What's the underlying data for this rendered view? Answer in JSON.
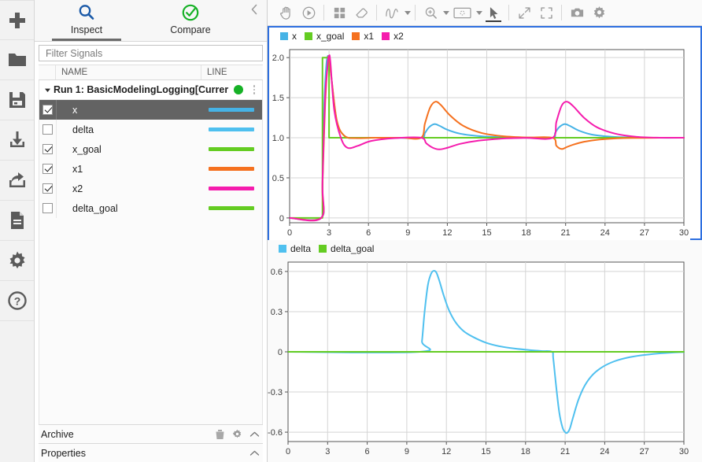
{
  "rail": {
    "items": [
      {
        "name": "add-icon",
        "label": "Add"
      },
      {
        "name": "open-folder-icon",
        "label": "Open"
      },
      {
        "name": "save-icon",
        "label": "Save"
      },
      {
        "name": "import-icon",
        "label": "Import"
      },
      {
        "name": "share-export-icon",
        "label": "Share"
      },
      {
        "name": "report-icon",
        "label": "Report"
      },
      {
        "name": "preferences-gear-icon",
        "label": "Preferences"
      },
      {
        "name": "help-icon",
        "label": "Help"
      }
    ]
  },
  "panel": {
    "tabs": [
      {
        "label": "Inspect",
        "icon": "search-icon",
        "active": true
      },
      {
        "label": "Compare",
        "icon": "compare-check-icon",
        "active": false
      }
    ],
    "collapse_icon": "chevron-left-icon",
    "filter": {
      "value": "",
      "placeholder": "Filter Signals"
    },
    "columns": {
      "check": "",
      "name": "NAME",
      "line": "LINE"
    },
    "run": {
      "label": "Run 1: BasicModelingLogging[Currer",
      "expanded": true,
      "dot_color": "#16b126"
    },
    "signals": [
      {
        "name": "x",
        "checked": true,
        "color": "#46b3e6",
        "selected": true
      },
      {
        "name": "delta",
        "checked": false,
        "color": "#4fc0ef",
        "selected": false
      },
      {
        "name": "x_goal",
        "checked": true,
        "color": "#64cc22",
        "selected": false
      },
      {
        "name": "x1",
        "checked": true,
        "color": "#f5711f",
        "selected": false
      },
      {
        "name": "x2",
        "checked": true,
        "color": "#f51cad",
        "selected": false
      },
      {
        "name": "delta_goal",
        "checked": false,
        "color": "#64cc22",
        "selected": false
      }
    ],
    "sections": [
      {
        "label": "Archive",
        "icons": [
          "trash-icon",
          "gear-icon",
          "chevron-up-icon"
        ]
      },
      {
        "label": "Properties",
        "icons": [
          "chevron-up-icon"
        ]
      }
    ]
  },
  "toolbar": {
    "groups": [
      [
        {
          "name": "pan-hand-icon",
          "label": "Pan",
          "caret": false,
          "active": false
        },
        {
          "name": "play-cursor-icon",
          "label": "Cursors",
          "caret": false,
          "active": false
        }
      ],
      [
        {
          "name": "subplot-layout-icon",
          "label": "Subplot Layout",
          "caret": false,
          "active": false
        },
        {
          "name": "eraser-icon",
          "label": "Clear",
          "caret": false,
          "active": false
        }
      ],
      [
        {
          "name": "signal-style-icon",
          "label": "Signal Style",
          "caret": true,
          "active": false
        }
      ],
      [
        {
          "name": "zoom-in-icon",
          "label": "Zoom In",
          "caret": true,
          "active": false
        },
        {
          "name": "fit-to-view-icon",
          "label": "Fit to View",
          "caret": true,
          "active": false
        },
        {
          "name": "arrow-pointer-icon",
          "label": "Select",
          "caret": false,
          "active": true
        }
      ],
      [
        {
          "name": "expand-diagonal-icon",
          "label": "Expand",
          "caret": false,
          "active": false
        },
        {
          "name": "fullscreen-icon",
          "label": "Full Screen",
          "caret": false,
          "active": false
        }
      ],
      [
        {
          "name": "snapshot-camera-icon",
          "label": "Snapshot",
          "caret": false,
          "active": false
        },
        {
          "name": "settings-gear-icon",
          "label": "Settings",
          "caret": false,
          "active": false
        }
      ]
    ]
  },
  "chart_data": [
    {
      "id": "upper",
      "type": "line",
      "title": "",
      "xlabel": "",
      "ylabel": "",
      "xlim": [
        0,
        30
      ],
      "ylim": [
        -0.06,
        2.1
      ],
      "xticks": [
        0,
        3,
        6,
        9,
        12,
        15,
        18,
        21,
        24,
        27,
        30
      ],
      "yticks": [
        0,
        0.5,
        1.0,
        1.5,
        2.0
      ],
      "ytick_labels": [
        "0",
        "0.5",
        "1.0",
        "1.5",
        "2.0"
      ],
      "grid": true,
      "legend_position": "top-left",
      "selected": true,
      "series": [
        {
          "name": "x",
          "color": "#46b3e6",
          "x": [
            0,
            2.4,
            2.5,
            2.6,
            2.8,
            3.0,
            3.2,
            3.6,
            4.2,
            5.0,
            6.0,
            8.0,
            10.0,
            10.3,
            10.6,
            11.0,
            11.4,
            12.0,
            13.0,
            14.5,
            16.0,
            18.0,
            20.0,
            20.2,
            20.5,
            20.9,
            21.3,
            22.0,
            23.0,
            24.5,
            26.0,
            28.0,
            30.0
          ],
          "y": [
            0,
            0,
            0.35,
            1.25,
            1.92,
            2.0,
            1.72,
            1.2,
            1.02,
            0.995,
            1.0,
            1.0,
            1.0,
            1.06,
            1.13,
            1.17,
            1.15,
            1.1,
            1.05,
            1.02,
            1.008,
            1.001,
            1.0,
            1.06,
            1.13,
            1.17,
            1.15,
            1.09,
            1.04,
            1.013,
            1.004,
            1.0,
            1.0
          ]
        },
        {
          "name": "x_goal",
          "color": "#64cc22",
          "x": [
            0,
            2.5,
            2.5,
            3.0,
            3.0,
            30
          ],
          "y": [
            0,
            0,
            2.0,
            2.0,
            1.0,
            1.0
          ]
        },
        {
          "name": "x1",
          "color": "#f5711f",
          "x": [
            0,
            2.4,
            2.5,
            2.7,
            2.9,
            3.0,
            3.2,
            3.6,
            4.2,
            5.2,
            6.5,
            8.5,
            10.0,
            10.3,
            10.7,
            11.1,
            11.5,
            12.2,
            13.2,
            14.6,
            16.2,
            18.0,
            20.0,
            20.3,
            20.7,
            21.1,
            21.6,
            22.4,
            23.4,
            24.8,
            26.4,
            28.2,
            30.0
          ],
          "y": [
            0,
            0,
            0.4,
            1.4,
            1.93,
            2.0,
            1.72,
            1.21,
            1.02,
            0.995,
            1.0,
            1.0,
            1.0,
            1.18,
            1.38,
            1.45,
            1.41,
            1.28,
            1.15,
            1.06,
            1.02,
            1.004,
            1.0,
            0.9,
            0.86,
            0.885,
            0.915,
            0.95,
            0.975,
            0.992,
            0.998,
            1.0,
            1.0
          ]
        },
        {
          "name": "x2",
          "color": "#f51cad",
          "x": [
            0,
            2.4,
            2.5,
            2.7,
            2.9,
            3.0,
            3.1,
            3.4,
            3.9,
            4.4,
            5.2,
            6.2,
            8.0,
            10.0,
            10.4,
            10.9,
            11.4,
            12.0,
            13.0,
            14.4,
            16.2,
            18.0,
            20.0,
            20.3,
            20.7,
            21.1,
            21.6,
            22.4,
            23.4,
            24.8,
            26.4,
            28.2,
            30.0
          ],
          "y": [
            0,
            0,
            0.45,
            1.5,
            1.92,
            2.02,
            1.95,
            1.34,
            1.0,
            0.875,
            0.9,
            0.96,
            0.995,
            1.0,
            0.93,
            0.875,
            0.855,
            0.875,
            0.925,
            0.965,
            0.99,
            0.998,
            1.0,
            1.2,
            1.4,
            1.45,
            1.39,
            1.25,
            1.13,
            1.05,
            1.012,
            1.001,
            1.0
          ]
        }
      ],
      "legend": [
        {
          "label": "x",
          "color": "#46b3e6"
        },
        {
          "label": "x_goal",
          "color": "#64cc22"
        },
        {
          "label": "x1",
          "color": "#f5711f"
        },
        {
          "label": "x2",
          "color": "#f51cad"
        }
      ]
    },
    {
      "id": "lower",
      "type": "line",
      "title": "",
      "xlabel": "",
      "ylabel": "",
      "xlim": [
        0,
        30
      ],
      "ylim": [
        -0.67,
        0.67
      ],
      "xticks": [
        0,
        3,
        6,
        9,
        12,
        15,
        18,
        21,
        24,
        27,
        30
      ],
      "yticks": [
        -0.6,
        -0.3,
        0,
        0.3,
        0.6
      ],
      "ytick_labels": [
        "-0.6",
        "-0.3",
        "0",
        "0.3",
        "0.6"
      ],
      "grid": true,
      "legend_position": "top-left",
      "selected": false,
      "series": [
        {
          "name": "delta",
          "color": "#4fc0ef",
          "x": [
            0,
            10.0,
            10.15,
            10.35,
            10.6,
            10.85,
            11.05,
            11.25,
            11.5,
            11.8,
            12.2,
            12.7,
            13.3,
            14.0,
            15.0,
            16.0,
            17.2,
            18.2,
            19.2,
            20.0,
            20.1,
            20.3,
            20.55,
            20.8,
            21.0,
            21.15,
            21.35,
            21.6,
            22.0,
            22.5,
            23.1,
            23.8,
            24.7,
            25.7,
            26.8,
            28.0,
            29.2,
            30.0
          ],
          "y": [
            0,
            0,
            0.08,
            0.3,
            0.5,
            0.585,
            0.605,
            0.59,
            0.52,
            0.42,
            0.31,
            0.22,
            0.155,
            0.112,
            0.068,
            0.042,
            0.024,
            0.014,
            0.006,
            0.0,
            -0.05,
            -0.24,
            -0.45,
            -0.565,
            -0.6,
            -0.605,
            -0.575,
            -0.49,
            -0.36,
            -0.25,
            -0.17,
            -0.115,
            -0.072,
            -0.044,
            -0.026,
            -0.013,
            -0.005,
            -0.002
          ]
        },
        {
          "name": "delta_goal",
          "color": "#64cc22",
          "x": [
            0,
            30
          ],
          "y": [
            0,
            0
          ]
        }
      ],
      "legend": [
        {
          "label": "delta",
          "color": "#4fc0ef"
        },
        {
          "label": "delta_goal",
          "color": "#64cc22"
        }
      ]
    }
  ]
}
